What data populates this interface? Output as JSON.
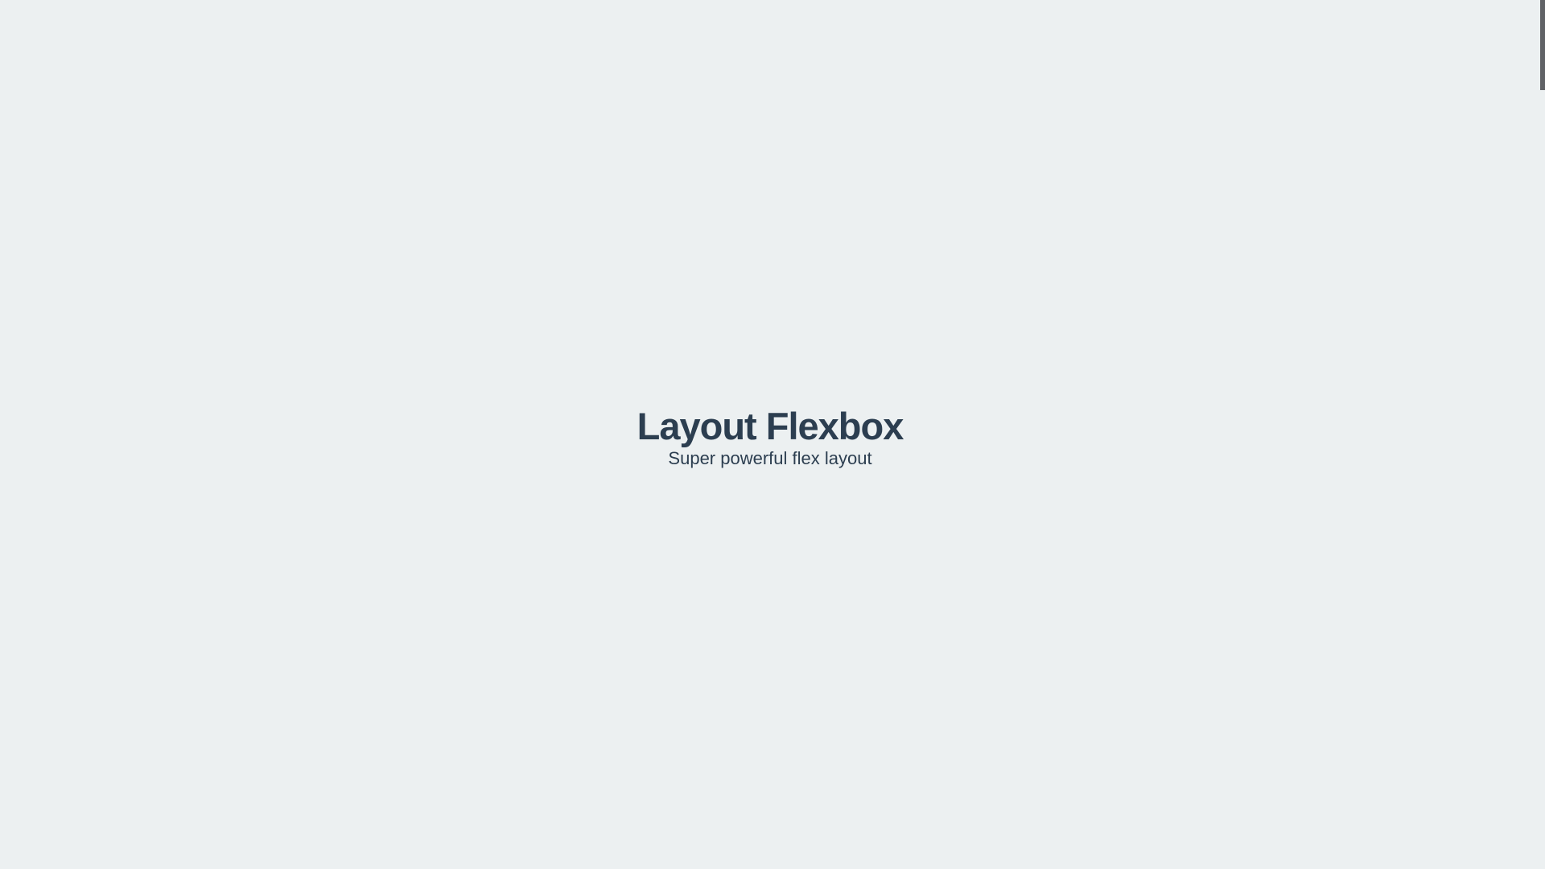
{
  "hero": {
    "title": "Layout Flexbox",
    "subtitle": "Super powerful flex layout"
  },
  "theme": {
    "background": "#ecf0f1",
    "text": "#2c3e50",
    "scrollbar_thumb": "#606266"
  }
}
